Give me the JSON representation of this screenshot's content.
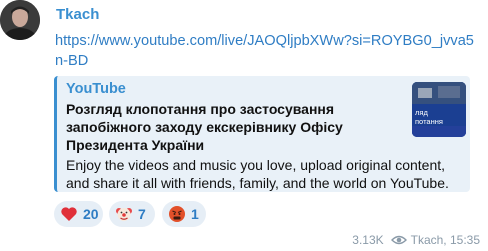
{
  "message": {
    "author": "Tkach",
    "link": "https://www.youtube.com/live/JAOQljpbXWw?si=ROYBG0_jvva5n-BD",
    "preview": {
      "site": "YouTube",
      "title": "Розгляд клопотання про застосування запобіжного заходу екскерівнику Офісу Президента України",
      "description": "Enjoy the videos and music you love, upload original content, and share it all with friends, family, and the world on YouTube.",
      "thumbnail_text": "ляд\nпотання"
    },
    "reactions": [
      {
        "emoji": "heart-emoji",
        "count": "20"
      },
      {
        "emoji": "clown-emoji",
        "count": "7"
      },
      {
        "emoji": "angry-face-emoji",
        "count": "1"
      }
    ],
    "views": "3.13K",
    "signature": "Tkach, 15:35"
  },
  "colors": {
    "accent": "#3a8fd0",
    "link": "#2f7dc4",
    "preview_bg": "#e9f1f8",
    "reaction_bg": "#e6eef6",
    "meta": "#8a9aa8"
  }
}
